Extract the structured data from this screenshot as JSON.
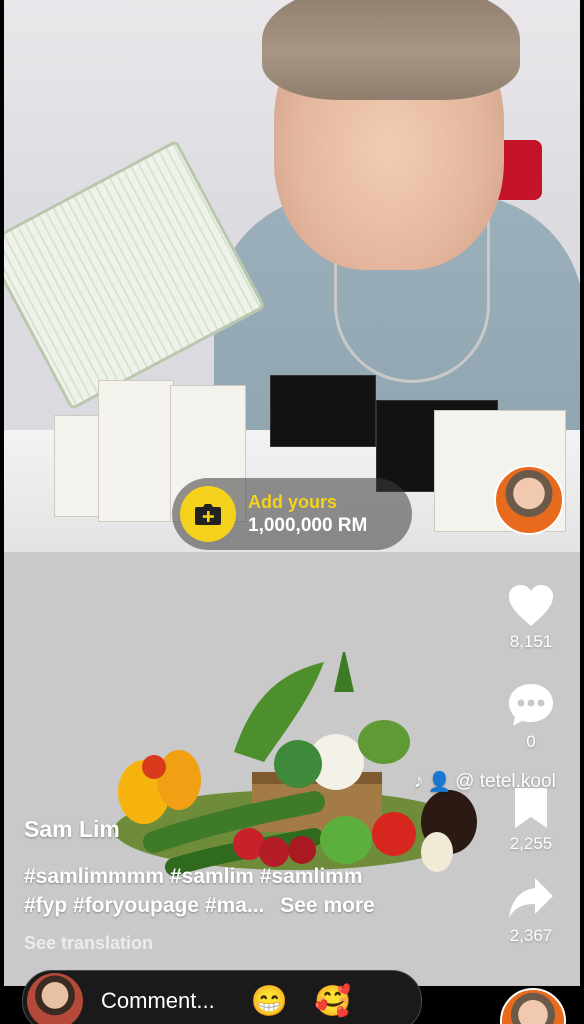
{
  "add_yours": {
    "title": "Add yours",
    "subtitle": "1,000,000 RM",
    "icon": "camera-plus-icon",
    "accent_color": "#f4d21c"
  },
  "rail": {
    "likes": "8,151",
    "comments": "0",
    "saves": "2,255",
    "shares": "2,367"
  },
  "handle": {
    "text": "@ tetel.kool",
    "icons": [
      "tiktok-icon",
      "people-icon"
    ]
  },
  "post": {
    "author": "Sam Lim",
    "caption_line1": "#samlimmmm #samlim #samlimm",
    "caption_line2": "#fyp #foryoupage #ma...",
    "see_more": "See more",
    "see_translation": "See translation"
  },
  "comment_bar": {
    "placeholder": "Comment...",
    "emoji1": "😁",
    "emoji2": "🥰"
  }
}
